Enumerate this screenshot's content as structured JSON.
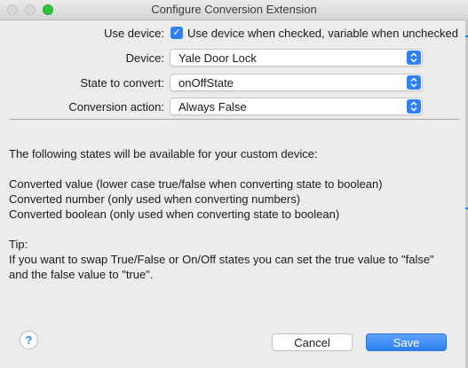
{
  "window": {
    "title": "Configure Conversion Extension"
  },
  "form": {
    "use_device_label": "Use device:",
    "use_device_checkbox_text": "Use device when checked, variable when unchecked",
    "use_device_checked": true,
    "device_label": "Device:",
    "device_value": "Yale Door Lock",
    "state_label": "State to convert:",
    "state_value": "onOffState",
    "action_label": "Conversion action:",
    "action_value": "Always False"
  },
  "info": {
    "intro": "The following states will be available for your custom device:",
    "states": [
      "Converted value (lower case true/false when converting state to boolean)",
      "Converted number (only used when converting numbers)",
      "Converted boolean (only used when converting state to boolean)"
    ],
    "tip_heading": "Tip:",
    "tip_lines": [
      "If you want to swap True/False or On/Off states you can set the true value to \"false\"",
      "and the false value to \"true\"."
    ]
  },
  "buttons": {
    "help": "?",
    "cancel": "Cancel",
    "save": "Save"
  },
  "colors": {
    "accent": "#2f7ff6",
    "background": "#ececec"
  }
}
